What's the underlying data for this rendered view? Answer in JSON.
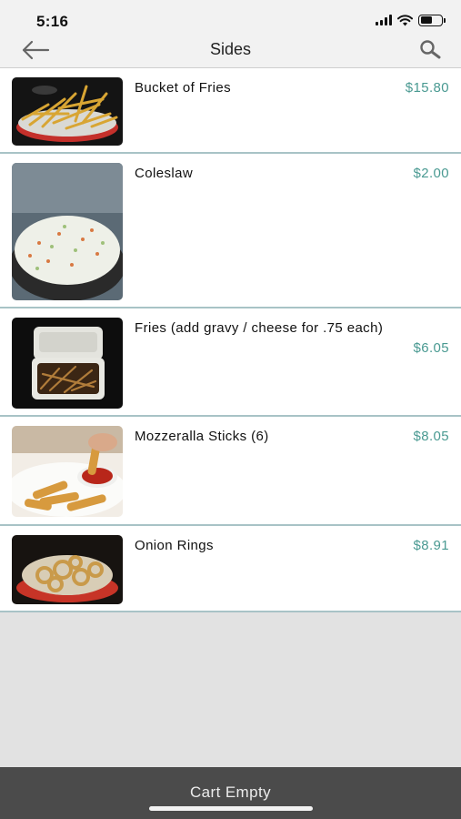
{
  "status_bar": {
    "time": "5:16",
    "icons": [
      "cellular-signal-icon",
      "wifi-icon",
      "battery-icon"
    ]
  },
  "nav": {
    "title": "Sides",
    "back_icon": "arrow-left-icon",
    "search_icon": "search-icon"
  },
  "items": [
    {
      "name": "Bucket of Fries",
      "price": "$15.80",
      "image": "fries-bucket-photo"
    },
    {
      "name": "Coleslaw",
      "price": "$2.00",
      "image": "coleslaw-photo"
    },
    {
      "name": "Fries (add gravy / cheese for .75 each)",
      "price": "$6.05",
      "image": "fries-container-photo"
    },
    {
      "name": "Mozzeralla Sticks (6)",
      "price": "$8.05",
      "image": "mozzarella-sticks-photo"
    },
    {
      "name": "Onion Rings",
      "price": "$8.91",
      "image": "onion-rings-photo"
    }
  ],
  "cart": {
    "label": "Cart Empty"
  },
  "colors": {
    "price": "#4a9a92",
    "divider": "#a8c3c6",
    "cart_bar": "#4b4b4b",
    "background": "#e2e2e2"
  }
}
